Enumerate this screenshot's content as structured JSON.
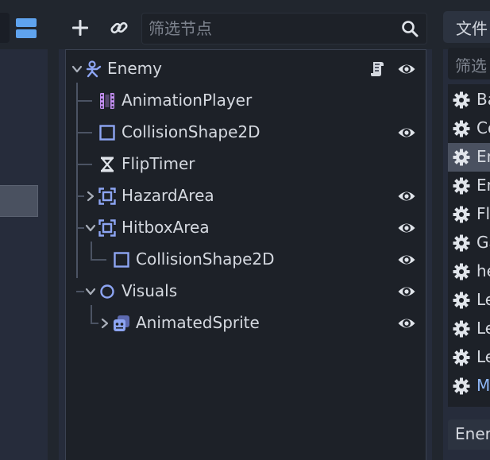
{
  "scene_toolbar": {
    "filter_placeholder": "筛选节点"
  },
  "tree": {
    "nodes": [
      {
        "label": "Enemy",
        "icon": "character-body-icon",
        "has_script": true,
        "visible_toggle": true,
        "expanded": true
      },
      {
        "label": "AnimationPlayer",
        "icon": "animation-player-icon",
        "visible_toggle": false
      },
      {
        "label": "CollisionShape2D",
        "icon": "collision-shape-icon",
        "visible_toggle": true
      },
      {
        "label": "FlipTimer",
        "icon": "timer-icon",
        "visible_toggle": false
      },
      {
        "label": "HazardArea",
        "icon": "area-icon",
        "visible_toggle": true,
        "expanded": false
      },
      {
        "label": "HitboxArea",
        "icon": "area-icon",
        "visible_toggle": true,
        "expanded": true
      },
      {
        "label": "CollisionShape2D",
        "icon": "collision-shape-icon",
        "visible_toggle": true
      },
      {
        "label": "Visuals",
        "icon": "node2d-icon",
        "visible_toggle": true,
        "expanded": true
      },
      {
        "label": "AnimatedSprite",
        "icon": "animated-sprite-icon",
        "visible_toggle": true,
        "expanded": false
      }
    ]
  },
  "file_panel": {
    "tab_label": "文件",
    "filter_placeholder": "筛选",
    "files": [
      {
        "label": "Ba",
        "selected": false,
        "accent": false
      },
      {
        "label": "Co",
        "selected": false,
        "accent": false
      },
      {
        "label": "En",
        "selected": true,
        "accent": false
      },
      {
        "label": "En",
        "selected": false,
        "accent": false
      },
      {
        "label": "Fl",
        "selected": false,
        "accent": false
      },
      {
        "label": "Ga",
        "selected": false,
        "accent": false
      },
      {
        "label": "he",
        "selected": false,
        "accent": false
      },
      {
        "label": "Le",
        "selected": false,
        "accent": false
      },
      {
        "label": "Le",
        "selected": false,
        "accent": false
      },
      {
        "label": "Le",
        "selected": false,
        "accent": false
      },
      {
        "label": "M",
        "selected": false,
        "accent": true
      }
    ],
    "bottom_tab_label": "Ener"
  },
  "colors": {
    "icon_accent": "#8da5f3",
    "animation_icon": "#c38ef1",
    "file_accent": "#8eb6f5",
    "toolbar_blue": "#5fa3ee"
  }
}
